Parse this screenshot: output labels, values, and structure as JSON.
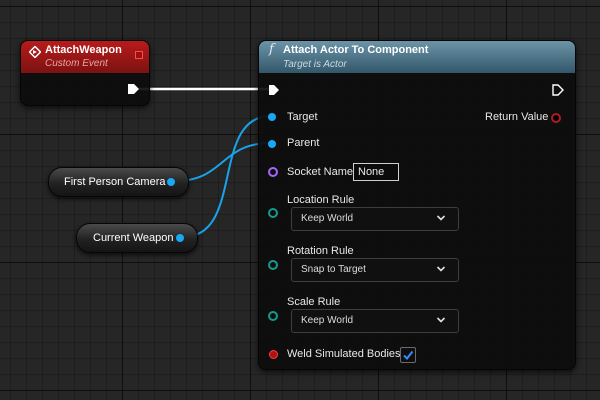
{
  "event_node": {
    "title": "AttachWeapon",
    "subtitle": "Custom Event"
  },
  "function_node": {
    "icon": "function-icon",
    "icon_glyph": "f",
    "title": "Attach Actor To Component",
    "subtitle": "Target is Actor",
    "pins": {
      "target": "Target",
      "parent": "Parent",
      "socket_name": "Socket Name",
      "socket_value": "None",
      "return_value": "Return Value",
      "location_rule": "Location Rule",
      "location_rule_value": "Keep World",
      "rotation_rule": "Rotation Rule",
      "rotation_rule_value": "Snap to Target",
      "scale_rule": "Scale Rule",
      "scale_rule_value": "Keep World",
      "weld_simulated_bodies": "Weld Simulated Bodies",
      "weld_simulated_bodies_checked": true
    }
  },
  "variables": [
    {
      "label": "First Person Camera"
    },
    {
      "label": "Current Weapon"
    }
  ],
  "colors": {
    "event_header": "#b81b1b",
    "function_header": "#4e7a8f",
    "object_pin": "#18a8f4",
    "name_pin": "#a866ff",
    "enum_pin": "#159a8c",
    "bool_pin": "#b01212",
    "exec_wire": "#ffffff",
    "object_wire": "#1aa3e8"
  }
}
